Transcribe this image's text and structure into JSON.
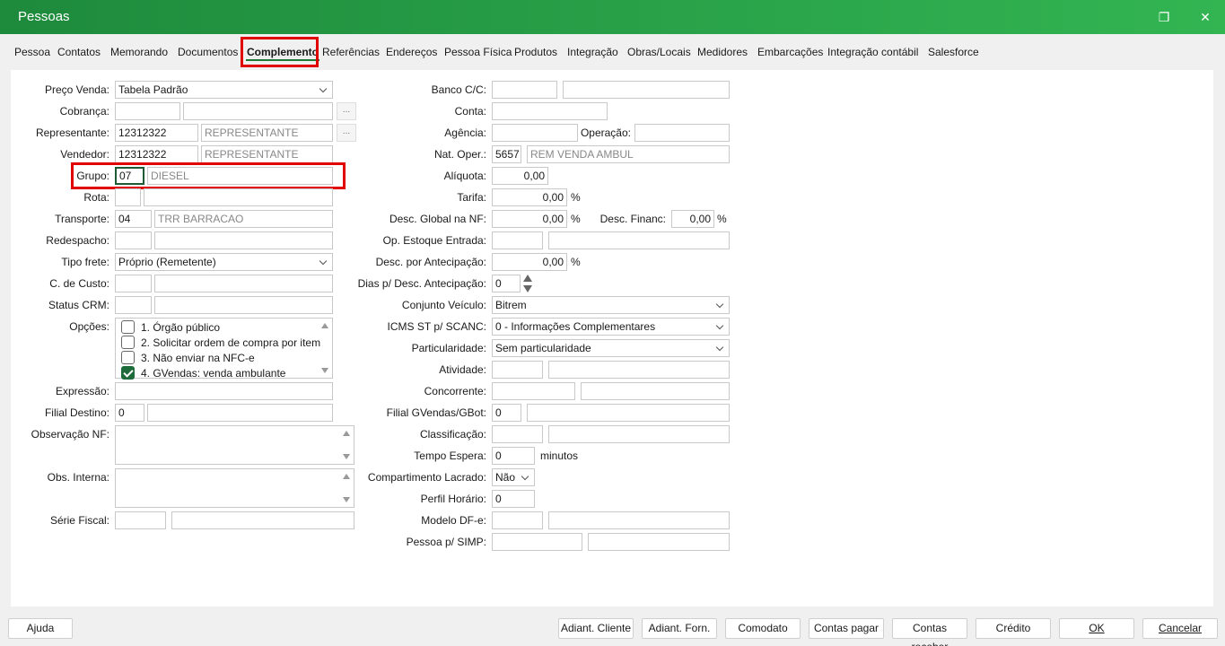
{
  "window": {
    "title": "Pessoas",
    "restore_glyph": "❐",
    "close_glyph": "✕"
  },
  "tabs": [
    "Pessoa",
    "Contatos",
    "Memorando",
    "Documentos",
    "Complemento",
    "Referências",
    "Endereços",
    "Pessoa Física",
    "Produtos",
    "Integração",
    "Obras/Locais",
    "Medidores",
    "Embarcações",
    "Integração contábil",
    "Salesforce"
  ],
  "left": {
    "preco_venda": {
      "label": "Preço Venda:",
      "value": "Tabela Padrão"
    },
    "cobranca": {
      "label": "Cobrança:",
      "code": "",
      "name": ""
    },
    "representante": {
      "label": "Representante:",
      "code": "12312322",
      "name": "REPRESENTANTE"
    },
    "vendedor": {
      "label": "Vendedor:",
      "code": "12312322",
      "name": "REPRESENTANTE"
    },
    "grupo": {
      "label": "Grupo:",
      "code": "07",
      "name": "DIESEL"
    },
    "rota": {
      "label": "Rota:",
      "code": "",
      "name": ""
    },
    "transporte": {
      "label": "Transporte:",
      "code": "04",
      "name": "TRR BARRACAO"
    },
    "redespacho": {
      "label": "Redespacho:",
      "code": "",
      "name": ""
    },
    "tipo_frete": {
      "label": "Tipo frete:",
      "value": "Próprio (Remetente)"
    },
    "custo": {
      "label": "C. de Custo:",
      "code": "",
      "name": ""
    },
    "status_crm": {
      "label": "Status CRM:",
      "code": "",
      "name": ""
    },
    "opcoes": {
      "label": "Opções:",
      "items": [
        {
          "text": "1. Órgão público",
          "checked": false
        },
        {
          "text": "2. Solicitar ordem de compra por item",
          "checked": false
        },
        {
          "text": "3. Não enviar na NFC-e",
          "checked": false
        },
        {
          "text": "4. GVendas: venda ambulante",
          "checked": true
        }
      ]
    },
    "expressao": {
      "label": "Expressão:",
      "value": ""
    },
    "filial_destino": {
      "label": "Filial Destino:",
      "code": "0",
      "name": ""
    },
    "obs_nf": {
      "label": "Observação NF:",
      "value": ""
    },
    "obs_interna": {
      "label": "Obs. Interna:",
      "value": ""
    },
    "serie_fiscal": {
      "label": "Série Fiscal:",
      "code": "",
      "name": ""
    },
    "dots_label": "..."
  },
  "right": {
    "banco": {
      "label": "Banco C/C:",
      "code": "",
      "name": ""
    },
    "conta": {
      "label": "Conta:",
      "value": ""
    },
    "agencia": {
      "label": "Agência:",
      "value": ""
    },
    "operacao": {
      "label": "Operação:",
      "value": ""
    },
    "nat_oper": {
      "label": "Nat. Oper.:",
      "code": "5657",
      "name": "REM VENDA AMBUL"
    },
    "aliquota": {
      "label": "Alíquota:",
      "value": "0,00"
    },
    "tarifa": {
      "label": "Tarifa:",
      "value": "0,00",
      "unit": "%"
    },
    "desc_global": {
      "label": "Desc. Global na NF:",
      "value": "0,00",
      "unit": "%"
    },
    "desc_financ": {
      "label": "Desc. Financ:",
      "value": "0,00",
      "unit": "%"
    },
    "op_estoque": {
      "label": "Op. Estoque Entrada:",
      "code": "",
      "name": ""
    },
    "desc_antecip": {
      "label": "Desc. por Antecipação:",
      "value": "0,00",
      "unit": "%"
    },
    "dias_antecip": {
      "label": "Dias p/ Desc. Antecipação:",
      "value": "0"
    },
    "conjunto_veiculo": {
      "label": "Conjunto Veículo:",
      "value": "Bitrem"
    },
    "icms_st": {
      "label": "ICMS ST p/ SCANC:",
      "value": "0 - Informações Complementares"
    },
    "particularidade": {
      "label": "Particularidade:",
      "value": "Sem particularidade"
    },
    "atividade": {
      "label": "Atividade:",
      "code": "",
      "name": ""
    },
    "concorrente": {
      "label": "Concorrente:",
      "code": "",
      "name": ""
    },
    "filial_gvendas": {
      "label": "Filial GVendas/GBot:",
      "code": "0",
      "name": ""
    },
    "classificacao": {
      "label": "Classificação:",
      "code": "",
      "name": ""
    },
    "tempo_espera": {
      "label": "Tempo Espera:",
      "value": "0",
      "unit": "minutos"
    },
    "compartimento": {
      "label": "Compartimento Lacrado:",
      "value": "Não"
    },
    "perfil_horario": {
      "label": "Perfil Horário:",
      "value": "0"
    },
    "modelo_dfe": {
      "label": "Modelo DF-e:",
      "code": "",
      "name": ""
    },
    "pessoa_simp": {
      "label": "Pessoa p/ SIMP:",
      "code": "",
      "name": ""
    }
  },
  "buttons": {
    "ajuda": "Ajuda",
    "adiant_cliente": "Adiant. Cliente",
    "adiant_forn": "Adiant. Forn.",
    "comodato": "Comodato",
    "contas_pagar": "Contas pagar",
    "contas_receber": "Contas receber",
    "credito": "Crédito",
    "ok": "OK",
    "cancelar": "Cancelar"
  }
}
